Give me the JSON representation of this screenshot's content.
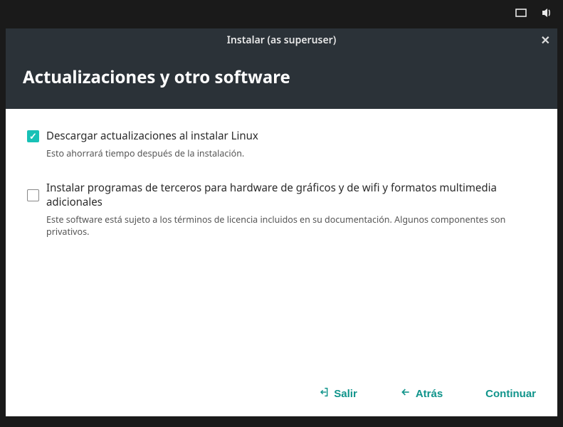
{
  "panel": {
    "maximize_icon": "maximize",
    "volume_icon": "volume"
  },
  "window": {
    "title": "Instalar (as superuser)",
    "heading": "Actualizaciones y otro software"
  },
  "options": [
    {
      "checked": true,
      "label": "Descargar actualizaciones al instalar Linux",
      "description": "Esto ahorrará tiempo después de la instalación."
    },
    {
      "checked": false,
      "label": "Instalar programas de terceros para hardware de gráficos y de wifi y formatos multimedia adicionales",
      "description": "Este software está sujeto a los términos de licencia incluidos en su documentación. Algunos componentes son privativos."
    }
  ],
  "buttons": {
    "quit": "Salir",
    "back": "Atrás",
    "continue": "Continuar"
  }
}
